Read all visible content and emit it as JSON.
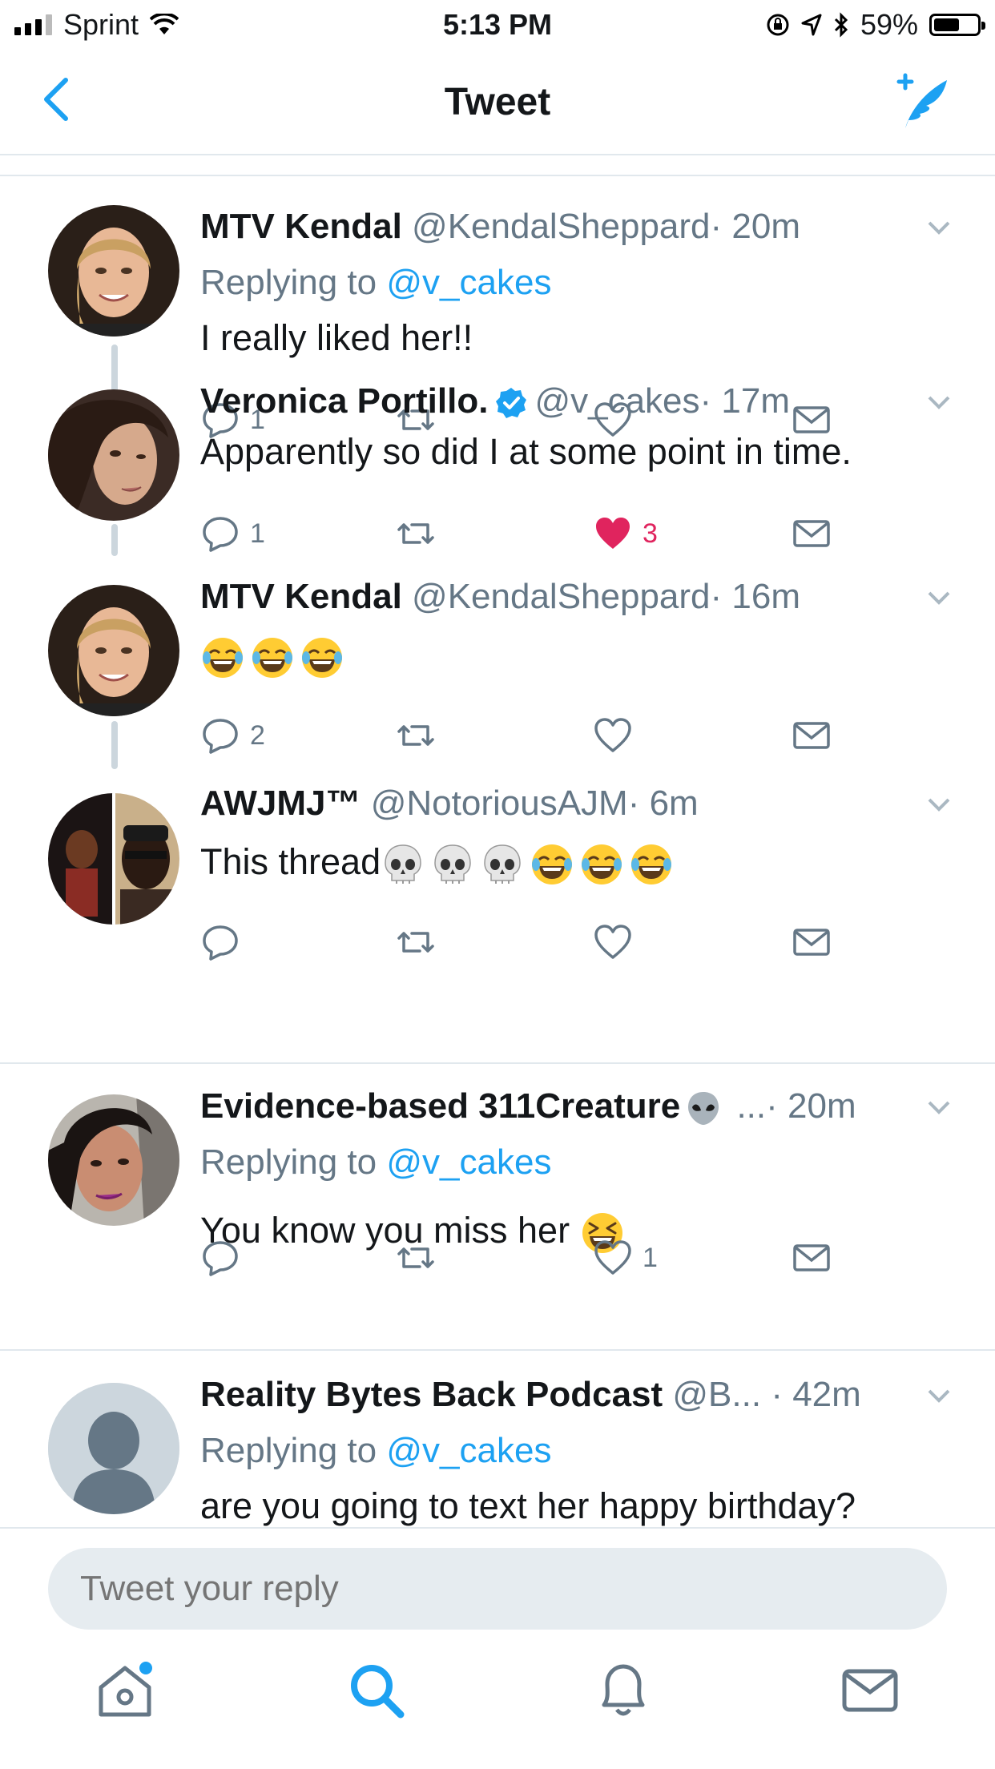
{
  "status_bar": {
    "carrier": "Sprint",
    "time": "5:13 PM",
    "battery_percent": "59%",
    "battery_level": 0.59
  },
  "nav": {
    "title": "Tweet",
    "back_icon": "chevron-left-icon",
    "compose_icon": "compose-tweet-icon"
  },
  "colors": {
    "accent": "#1da1f2",
    "like": "#e0245e",
    "secondary_text": "#657786",
    "divider": "#e1e8ed"
  },
  "tweets": [
    {
      "name": "MTV Kendal",
      "handle": "@KendalSheppard",
      "time": "· 20m",
      "replying_label": "Replying to",
      "replying_to": "@v_cakes",
      "text": "I really liked her!!",
      "reply_count": "1",
      "retweet_count": "",
      "like_count": ""
    },
    {
      "name": "Veronica Portillo.",
      "handle": "@v_cakes",
      "time": "· 17m",
      "verified": true,
      "text": "Apparently so did I at some point in time.",
      "reply_count": "1",
      "retweet_count": "",
      "like_count": "3",
      "liked": true
    },
    {
      "name": "MTV Kendal",
      "handle": "@KendalSheppard",
      "time": "· 16m",
      "text": "",
      "emojis": [
        "laugh-cry-emoji",
        "laugh-cry-emoji",
        "laugh-cry-emoji"
      ],
      "reply_count": "2",
      "retweet_count": "",
      "like_count": ""
    },
    {
      "name": "AWJMJ™",
      "handle": "@NotoriousAJM",
      "time": "· 6m",
      "text": "This thread",
      "emojis": [
        "skull-emoji",
        "skull-emoji",
        "skull-emoji",
        "laugh-cry-emoji",
        "laugh-cry-emoji",
        "laugh-cry-emoji"
      ],
      "reply_count": "",
      "retweet_count": "",
      "like_count": ""
    },
    {
      "name": "Evidence-based 311Creature",
      "name_emoji": "alien-emoji",
      "handle": "...",
      "time": "· 20m",
      "replying_label": "Replying to",
      "replying_to": "@v_cakes",
      "text": "You know you miss her",
      "emojis": [
        "grinning-squint-emoji"
      ],
      "reply_count": "",
      "retweet_count": "",
      "like_count": "1"
    },
    {
      "name": "Reality Bytes Back Podcast",
      "handle": "@B...",
      "time": "· 42m",
      "replying_label": "Replying to",
      "replying_to": "@v_cakes",
      "text": "are you going to text her happy birthday?"
    }
  ],
  "reply_box": {
    "placeholder": "Tweet your reply"
  },
  "tab_bar": {
    "items": [
      "home-icon",
      "search-icon",
      "notifications-icon",
      "messages-icon"
    ],
    "active": "search-icon"
  }
}
